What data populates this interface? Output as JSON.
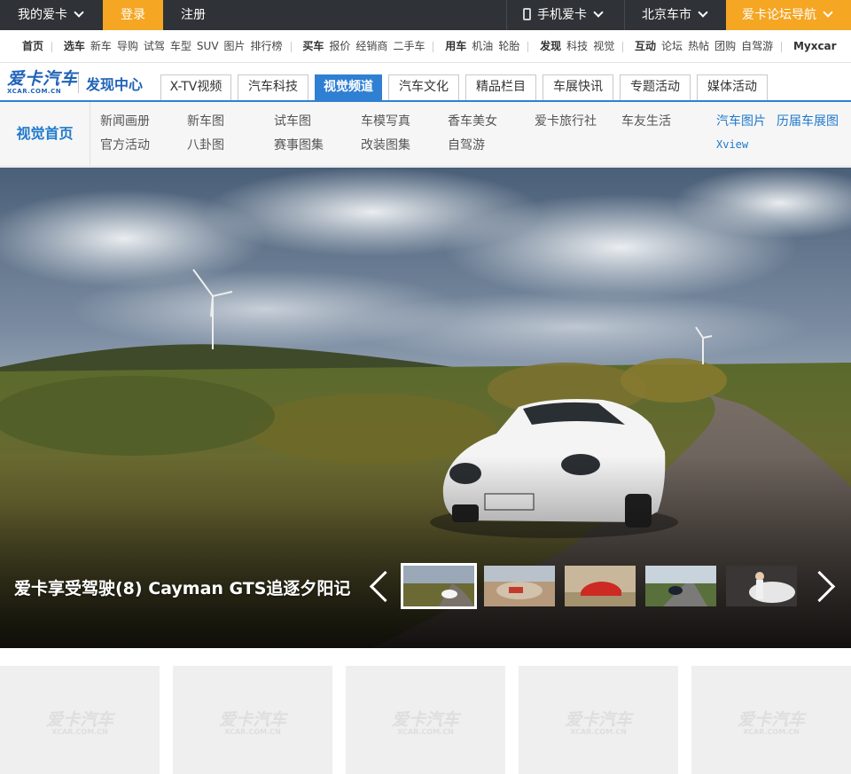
{
  "topbar": {
    "my_xcar": "我的爱卡",
    "login": "登录",
    "register": "注册",
    "mobile": "手机爱卡",
    "city": "北京车市",
    "forum_nav": "爱卡论坛导航"
  },
  "subnav": {
    "groups": [
      [
        "首页"
      ],
      [
        "选车",
        "新车",
        "导购",
        "试驾",
        "车型",
        "SUV",
        "图片",
        "排行榜"
      ],
      [
        "买车",
        "报价",
        "经销商",
        "二手车"
      ],
      [
        "用车",
        "机油",
        "轮胎"
      ],
      [
        "发现",
        "科技",
        "视觉"
      ],
      [
        "互动",
        "论坛",
        "热帖",
        "团购",
        "自驾游"
      ],
      [
        "Myxcar"
      ]
    ]
  },
  "header": {
    "logo_main": "爱卡汽车",
    "logo_sub": "XCAR.COM.CN",
    "site_title": "发现中心",
    "tabs": [
      "X-TV视频",
      "汽车科技",
      "视觉频道",
      "汽车文化",
      "精品栏目",
      "车展快讯",
      "专题活动",
      "媒体活动"
    ],
    "active_tab": "视觉频道"
  },
  "submenu": {
    "home": "视觉首页",
    "row1": [
      "新闻画册",
      "新车图",
      "试车图",
      "车模写真",
      "香车美女",
      "爱卡旅行社",
      "车友生活"
    ],
    "row2": [
      "官方活动",
      "八卦图",
      "赛事图集",
      "改装图集",
      "自驾游"
    ],
    "right": [
      "汽车图片",
      "历届车展图"
    ],
    "xview": "Xview"
  },
  "banner": {
    "caption": "爱卡享受驾驶(8) Cayman GTS追逐夕阳记",
    "thumbs": [
      "white-sports-car",
      "rally-car-desert",
      "red-coupe",
      "dark-sedan-road",
      "car-show-model"
    ]
  },
  "placeholders": {
    "logo_main": "爱卡汽车",
    "logo_sub": "XCAR.COM.CN"
  },
  "colors": {
    "topbar_bg": "#2f3337",
    "accent_orange": "#f5a623",
    "brand_blue": "#1f62b7",
    "tab_active": "#2f7fd2"
  }
}
